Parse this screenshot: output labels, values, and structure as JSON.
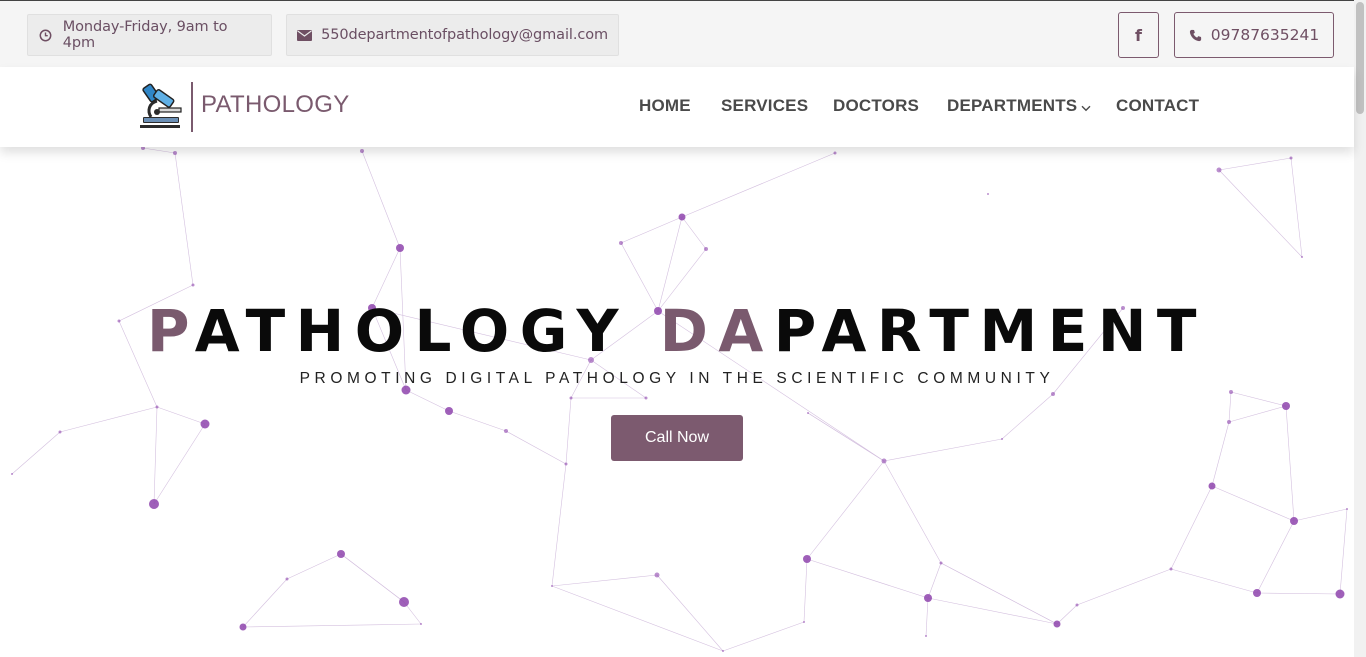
{
  "topbar": {
    "hours_text": "Monday-Friday, 9am to 4pm",
    "email_text": "550departmentofpathology@gmail.com",
    "facebook_label": "f",
    "phone_text": "09787635241"
  },
  "nav": {
    "brand": "PATHOLOGY",
    "items": [
      "HOME",
      "SERVICES",
      "DOCTORS",
      "DEPARTMENTS",
      "CONTACT"
    ]
  },
  "hero": {
    "title_accent_1": "P",
    "title_part_1": "ATHOLOGY ",
    "title_accent_2": "DA",
    "title_part_2": "PARTMENT",
    "subtitle": "PROMOTING DIGITAL PATHOLOGY IN THE SCIENTIFIC COMMUNITY",
    "cta_label": "Call Now"
  },
  "colors": {
    "accent": "#7a5a6e",
    "button": "#7c5a6f",
    "network_node": "#8e44ad"
  },
  "icons": {
    "hours": "clock-icon",
    "email": "envelope-icon",
    "facebook": "facebook-icon",
    "phone": "phone-icon",
    "logo": "microscope-icon",
    "dropdown": "chevron-down-icon"
  }
}
